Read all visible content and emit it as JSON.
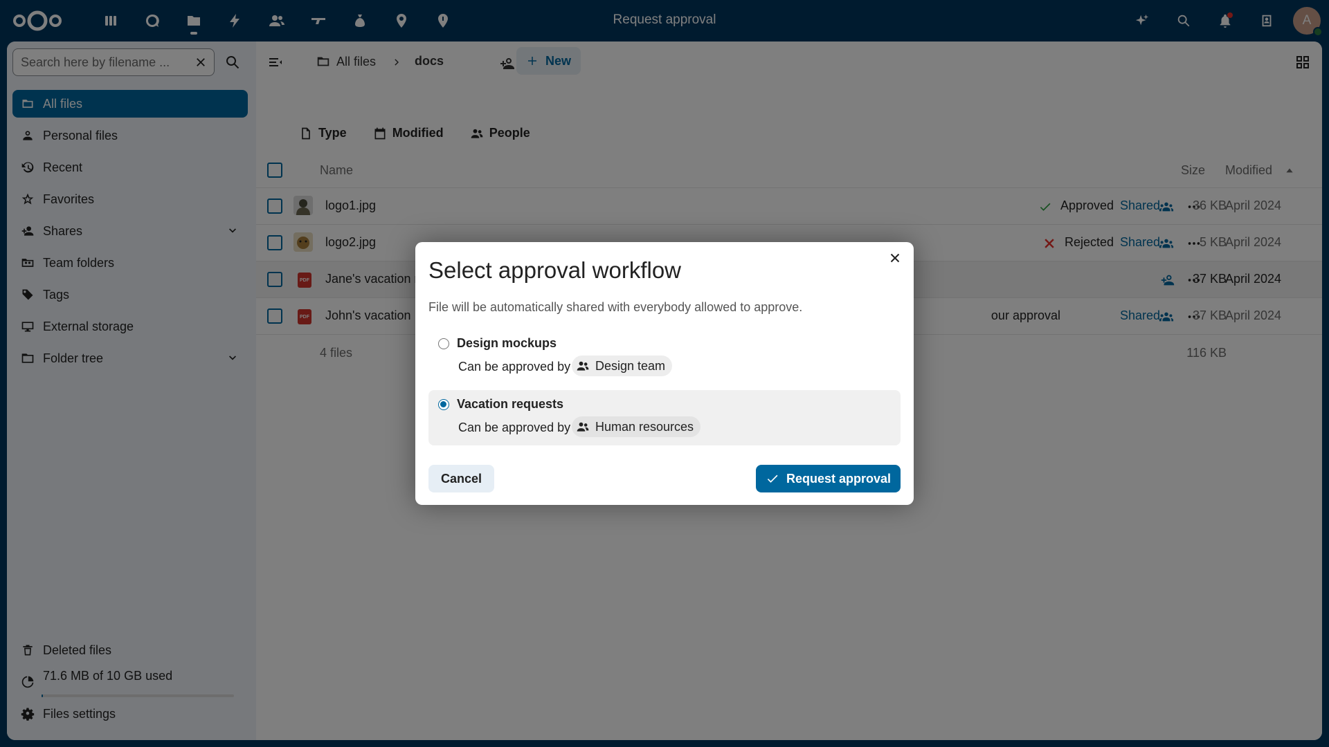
{
  "header": {
    "title": "Request approval",
    "apps": [
      "dashboard-icon",
      "search-circle-icon",
      "files-icon",
      "activity-icon",
      "contacts-icon",
      "deck-icon",
      "money-icon",
      "maps-icon",
      "location-icon"
    ],
    "avatar_initial": "A"
  },
  "sidebar": {
    "search_placeholder": "Search here by filename ...",
    "items": [
      {
        "label": "All files",
        "icon": "folder-icon",
        "active": true
      },
      {
        "label": "Personal files",
        "icon": "person-icon"
      },
      {
        "label": "Recent",
        "icon": "history-icon"
      },
      {
        "label": "Favorites",
        "icon": "star-icon"
      },
      {
        "label": "Shares",
        "icon": "share-icon",
        "expandable": true
      },
      {
        "label": "Team folders",
        "icon": "team-folder-icon"
      },
      {
        "label": "Tags",
        "icon": "tag-icon"
      },
      {
        "label": "External storage",
        "icon": "monitor-icon"
      },
      {
        "label": "Folder tree",
        "icon": "folder-tree-icon",
        "expandable": true
      }
    ],
    "deleted_files": "Deleted files",
    "quota": "71.6 MB of 10 GB used",
    "quota_fraction": 0.007,
    "settings": "Files settings"
  },
  "toolbar": {
    "breadcrumb_root": "All files",
    "breadcrumb_current": "docs",
    "new_label": "New"
  },
  "filters": [
    "Type",
    "Modified",
    "People"
  ],
  "table": {
    "col_name": "Name",
    "col_size": "Size",
    "col_modified": "Modified",
    "rows": [
      {
        "name": "logo1.jpg",
        "status": "Approved",
        "share": "Shared",
        "size": "36 KB",
        "modified": "April 2024"
      },
      {
        "name": "logo2.jpg",
        "status": "Rejected",
        "share": "Shared",
        "size": "5 KB",
        "modified": "April 2024"
      },
      {
        "name": "Jane's vacation request.pdf",
        "status": "",
        "share": "",
        "size": "37 KB",
        "modified": "April 2024"
      },
      {
        "name": "John's vacation",
        "status": "our approval",
        "share": "Shared",
        "size": "37 KB",
        "modified": "April 2024"
      }
    ],
    "footer_count": "4 files",
    "footer_size": "116 KB"
  },
  "dialog": {
    "title": "Select approval workflow",
    "description": "File will be automatically shared with everybody allowed to approve.",
    "workflows": [
      {
        "name": "Design mockups",
        "by_label": "Can be approved by",
        "approver": "Design team",
        "selected": false
      },
      {
        "name": "Vacation requests",
        "by_label": "Can be approved by",
        "approver": "Human resources",
        "selected": true
      }
    ],
    "cancel_label": "Cancel",
    "submit_label": "Request approval"
  },
  "colors": {
    "primary": "#00679e",
    "header_bg": "#00375f",
    "approved": "#2d9f41",
    "rejected": "#e9322d"
  }
}
